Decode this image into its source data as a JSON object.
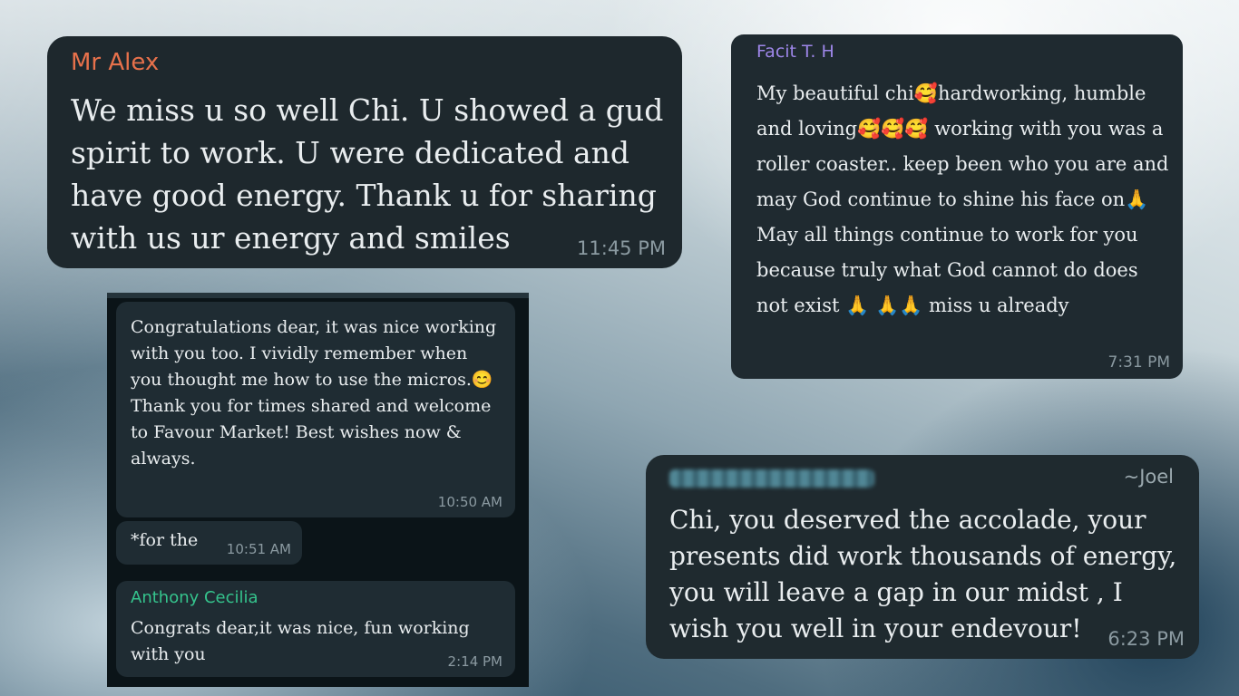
{
  "messages": {
    "mr_alex": {
      "sender": "Mr Alex",
      "text": "We miss u so well Chi. U showed a gud spirit to work. U were dedicated and have good energy. Thank u for sharing with us ur energy and smiles",
      "time": "11:45 PM",
      "colors": {
        "sender": "#e7714b"
      }
    },
    "facit": {
      "sender": "Facit T. H",
      "text": "My beautiful chi🥰hardworking, humble and loving🥰🥰🥰 working with you was a roller coaster.. keep been who you are and may God continue to shine his face on🙏 May all things continue to work for you because truly what God cannot do does not exist 🙏 🙏🙏 miss u already",
      "time": "7:31 PM",
      "colors": {
        "sender": "#9d86e8"
      }
    },
    "chat_panel": {
      "bubble1": {
        "text": "Congratulations dear, it was nice working with you too. I vividly remember when you thought me how to use the micros.😊 Thank you for times shared and welcome to Favour Market! Best wishes now & always.",
        "time": "10:50 AM"
      },
      "bubble2": {
        "text": "*for the",
        "time": "10:51 AM"
      },
      "bubble3": {
        "sender": "Anthony Cecilia",
        "text": "Congrats dear,it was nice, fun working with you",
        "time": "2:14 PM",
        "colors": {
          "sender": "#35c48d"
        }
      }
    },
    "joel": {
      "signature": "~Joel",
      "text": "Chi, you deserved the accolade, your presents did work thousands of energy, you will leave a gap in our midst , I wish you well in your endevour!",
      "time": "6:23 PM"
    }
  }
}
